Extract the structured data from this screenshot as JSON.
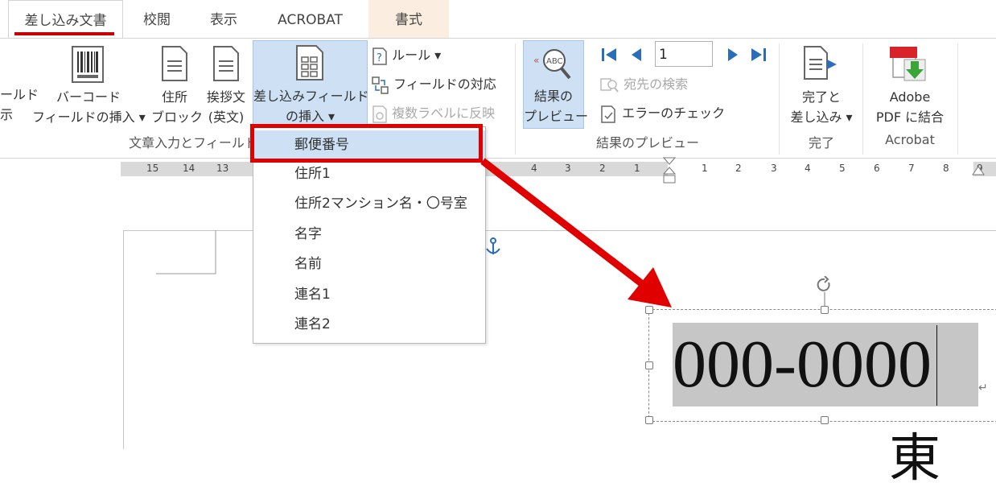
{
  "tabs": [
    {
      "label": "差し込み文書",
      "active": true
    },
    {
      "label": "校閲"
    },
    {
      "label": "表示"
    },
    {
      "label": "ACROBAT"
    },
    {
      "label": "書式",
      "contextual": true
    }
  ],
  "ribbon": {
    "field_display_partial": [
      "ールド",
      "示"
    ],
    "barcode_button": [
      "バーコード",
      "フィールドの挿入 ▾"
    ],
    "address_block_button": [
      "住所",
      "ブロック"
    ],
    "greeting_button": [
      "挨拶文",
      "(英文)"
    ],
    "insert_field_button": [
      "差し込みフィールド",
      "の挿入 ▾"
    ],
    "rules_label": "ルール ▾",
    "match_fields_label": "フィールドの対応",
    "update_labels_label": "複数ラベルに反映",
    "group_write_insert": "文章入力とフィールド",
    "preview_button": [
      "結果の",
      "プレビュー"
    ],
    "record_number": "1",
    "find_recipient_label": "宛先の検索",
    "check_errors_label": "エラーのチェック",
    "group_preview": "結果のプレビュー",
    "finish_button": [
      "完了と",
      "差し込み ▾"
    ],
    "group_finish": "完了",
    "adobe_button": [
      "Adobe",
      "PDF に結合"
    ],
    "group_acrobat": "Acrobat"
  },
  "ruler": {
    "left_numbers": [
      "15",
      "14",
      "13"
    ],
    "mid_numbers": [
      "4",
      "3",
      "2",
      "1"
    ],
    "right_numbers": [
      "1",
      "2",
      "3",
      "4",
      "5",
      "6",
      "7",
      "8",
      "9"
    ]
  },
  "dropdown": {
    "items": [
      "郵便番号",
      "住所1",
      "住所2マンション名・〇号室",
      "名字",
      "名前",
      "連名1",
      "連名2"
    ],
    "selected_index": 0
  },
  "document": {
    "zip_field": "000-0000",
    "partial_char": "東"
  },
  "colors": {
    "accent_red": "#e00000",
    "tab_underline": "#c80000",
    "highlight_blue": "#cde0f4",
    "field_shading": "#c6c6c6"
  }
}
